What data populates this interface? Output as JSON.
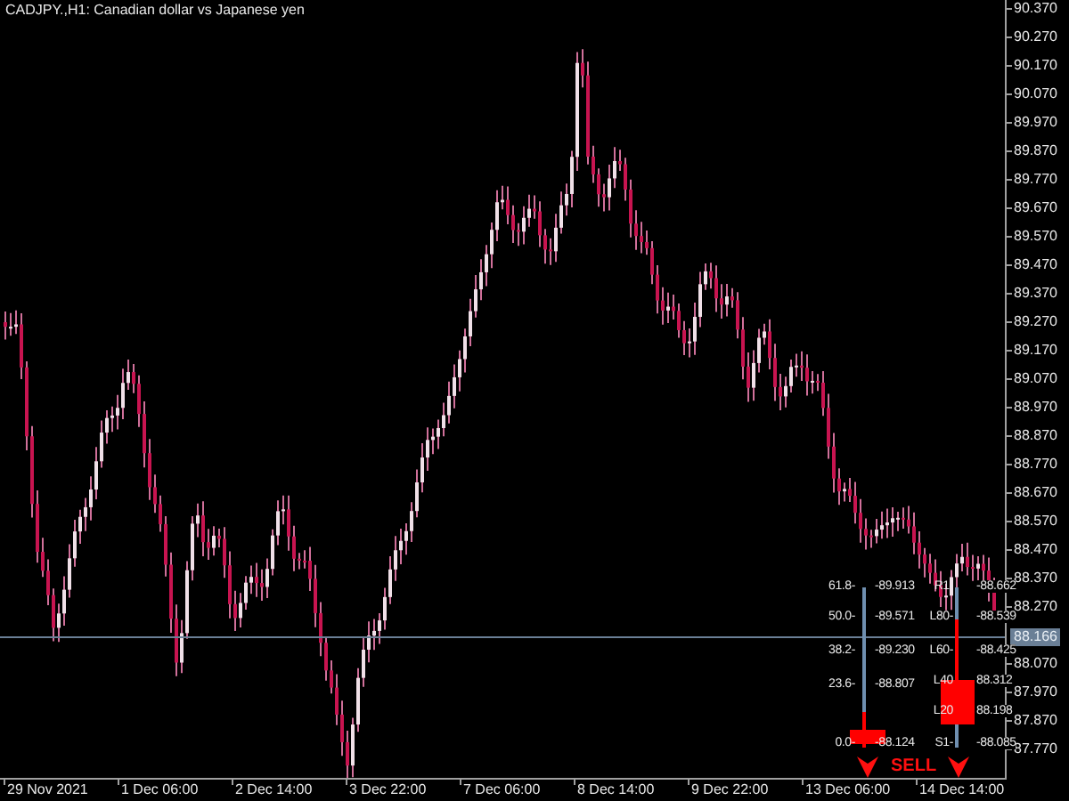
{
  "chart": {
    "title": "CADJPY.,H1:  Canadian dollar vs Japanese yen"
  },
  "price_axis": [
    "90.370",
    "90.270",
    "90.170",
    "90.070",
    "89.970",
    "89.870",
    "89.770",
    "89.670",
    "89.570",
    "89.470",
    "89.370",
    "89.270",
    "89.170",
    "89.070",
    "88.970",
    "88.870",
    "88.770",
    "88.670",
    "88.570",
    "88.470",
    "88.370",
    "88.270",
    "88.070",
    "87.970",
    "87.870",
    "87.770"
  ],
  "current_price": "88.166",
  "time_axis": [
    "29 Nov 2021",
    "1 Dec 06:00",
    "2 Dec 14:00",
    "3 Dec 22:00",
    "7 Dec 06:00",
    "8 Dec 14:00",
    "9 Dec 22:00",
    "13 Dec 06:00",
    "14 Dec 14:00"
  ],
  "fib_levels": [
    {
      "label": "61.8-",
      "value": "-89.913"
    },
    {
      "label": "50.0-",
      "value": "-89.571"
    },
    {
      "label": "38.2-",
      "value": "-89.230"
    },
    {
      "label": "23.6-",
      "value": "-88.807"
    },
    {
      "label": "0.0-",
      "value": "-88.124"
    }
  ],
  "pivot_levels": [
    {
      "label": "R1-",
      "value": "-88.662"
    },
    {
      "label": "L80-",
      "value": "-88.539"
    },
    {
      "label": "L60-",
      "value": "-88.425"
    },
    {
      "label": "L40",
      "value": "88.312"
    },
    {
      "label": "L20",
      "value": "88.198"
    },
    {
      "label": "S1-",
      "value": "-88.085"
    }
  ],
  "signal": "SELL"
}
